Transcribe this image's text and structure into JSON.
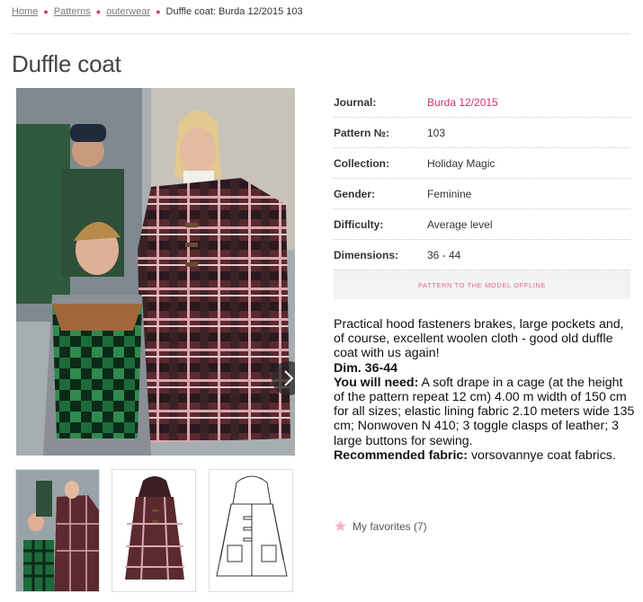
{
  "breadcrumb": {
    "home": "Home",
    "patterns": "Patterns",
    "category": "outerwear",
    "current": "Duffle coat: Burda 12/2015 103"
  },
  "page_title": "Duffle coat",
  "details": {
    "journal_label": "Journal:",
    "journal_value": "Burda 12/2015",
    "pattern_label": "Pattern №:",
    "pattern_value": "103",
    "collection_label": "Collection:",
    "collection_value": "Holiday Magic",
    "gender_label": "Gender:",
    "gender_value": "Feminine",
    "difficulty_label": "Difficulty:",
    "difficulty_value": "Average level",
    "dimensions_label": "Dimensions:",
    "dimensions_value": "36 - 44"
  },
  "offline_button": "PATTERN TO THE MODEL OFFLINE",
  "description": {
    "intro": "Practical hood fasteners brakes, large pockets and, of course, excellent woolen cloth - good old duffle coat with us again!",
    "dim": "Dim. 36-44",
    "need_label": "You will need:",
    "need_text": " A soft drape in a cage (at the height of the pattern repeat 12 cm) 4.00 m width of 150 cm for all sizes; elastic lining fabric 2.10 meters wide 135 cm; Nonwoven N 410; 3 toggle clasps of leather; 3 large buttons for sewing.",
    "fabric_label": "Recommended fabric:",
    "fabric_text": " vorsovannye coat fabrics."
  },
  "favorites": "My favorites (7)",
  "colors": {
    "accent": "#d6336c",
    "star": "#f5b5c8"
  },
  "icons": {
    "next": "chevron-right-icon",
    "favorite": "star-icon"
  }
}
